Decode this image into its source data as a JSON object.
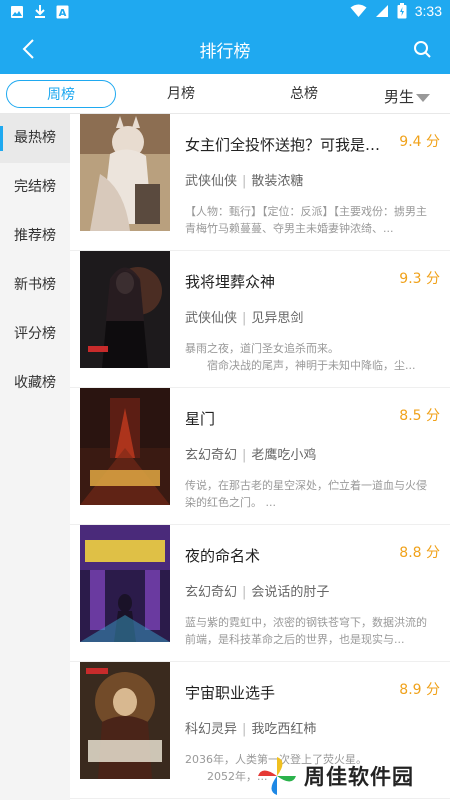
{
  "status_bar": {
    "time": "3:33",
    "icons": [
      "image-icon",
      "download-icon",
      "a-icon",
      "wifi-icon",
      "signal-icon",
      "battery-icon"
    ]
  },
  "appbar": {
    "title": "排行榜",
    "back_icon": "back-arrow-icon",
    "search_icon": "search-icon"
  },
  "tabs": [
    {
      "label": "周榜",
      "active": true
    },
    {
      "label": "月榜",
      "active": false
    },
    {
      "label": "总榜",
      "active": false
    }
  ],
  "gender_filter": {
    "label": "男生"
  },
  "sidebar": [
    {
      "label": "最热榜",
      "active": true
    },
    {
      "label": "完结榜",
      "active": false
    },
    {
      "label": "推荐榜",
      "active": false
    },
    {
      "label": "新书榜",
      "active": false
    },
    {
      "label": "评分榜",
      "active": false
    },
    {
      "label": "收藏榜",
      "active": false
    }
  ],
  "books": [
    {
      "title": "女主们全投怀送抱？可我是反派啊",
      "score": "9.4 分",
      "genre": "武侠仙侠",
      "author": "散装浓糖",
      "desc": "【人物：甄行】【定位：反派】【主要戏份：掳男主青梅竹马赖蔓蔓、夺男主未婚妻钟浓绮、..."
    },
    {
      "title": "我将埋葬众神",
      "score": "9.3 分",
      "genre": "武侠仙侠",
      "author": "见异思剑",
      "desc": "暴雨之夜，道门圣女追杀而来。\n　　宿命决战的尾声，神明于未知中降临，尘..."
    },
    {
      "title": "星门",
      "score": "8.5 分",
      "genre": "玄幻奇幻",
      "author": "老鹰吃小鸡",
      "desc": "传说，在那古老的星空深处，伫立着一道血与火侵染的红色之门。 ..."
    },
    {
      "title": "夜的命名术",
      "score": "8.8 分",
      "genre": "玄幻奇幻",
      "author": "会说话的肘子",
      "desc": "蓝与紫的霓虹中，浓密的钢铁苍穹下，数据洪流的前端，是科技革命之后的世界，也是现实与..."
    },
    {
      "title": "宇宙职业选手",
      "score": "8.9 分",
      "genre": "科幻灵异",
      "author": "我吃西红柿",
      "desc": "2036年，人类第一次登上了荧火星。\n　　2052年，..."
    }
  ],
  "watermark": {
    "text": "周佳软件园"
  },
  "colors": {
    "accent": "#1fa9f0",
    "score": "#f0a21b"
  }
}
